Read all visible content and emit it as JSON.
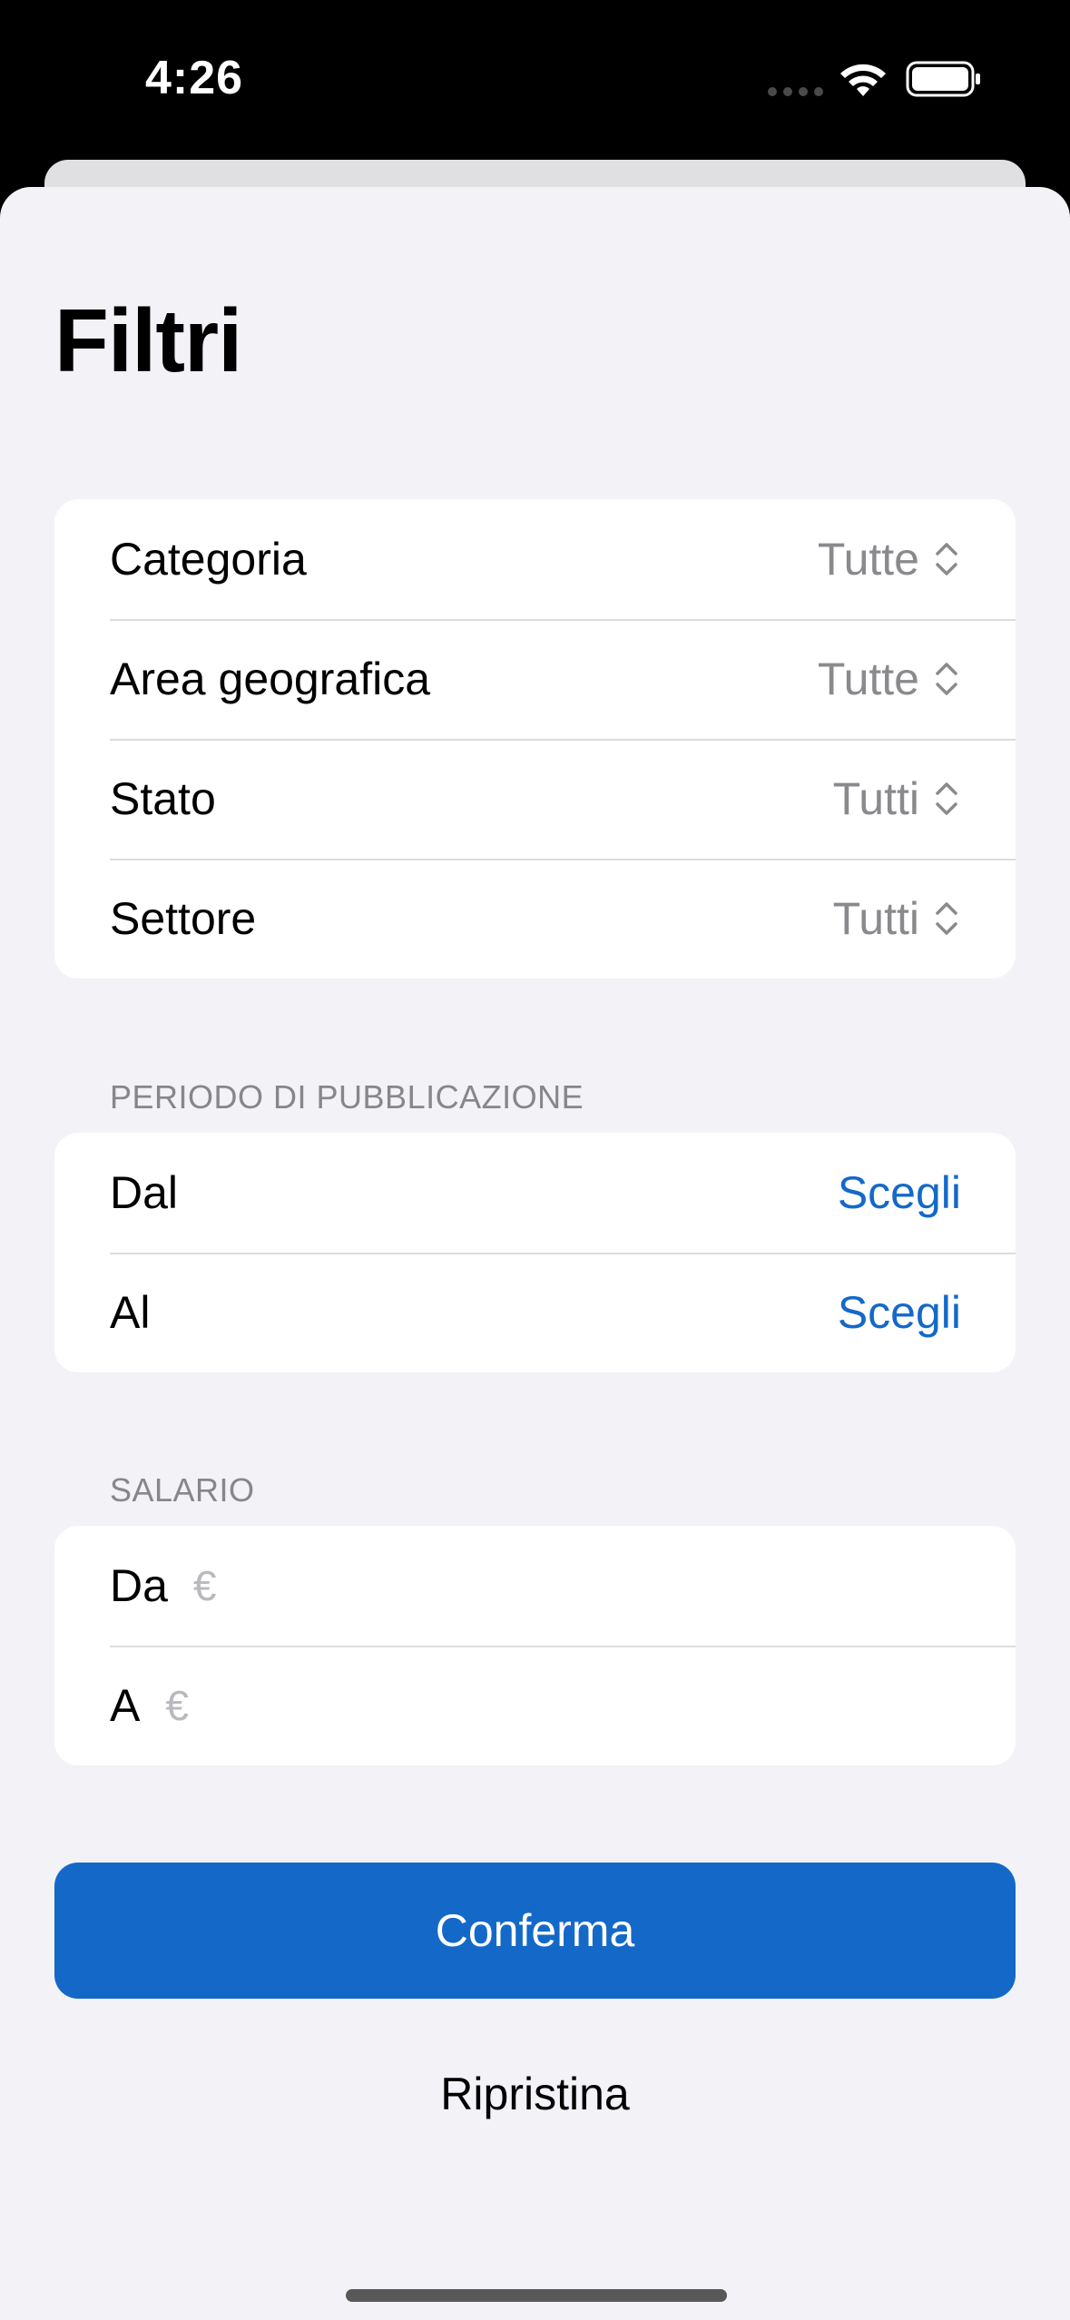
{
  "status_bar": {
    "time": "4:26"
  },
  "title": "Filtri",
  "filters": [
    {
      "label": "Categoria",
      "value": "Tutte",
      "icon": "chevron-up-down-icon"
    },
    {
      "label": "Area geografica",
      "value": "Tutte",
      "icon": "chevron-up-down-icon"
    },
    {
      "label": "Stato",
      "value": "Tutti",
      "icon": "chevron-up-down-icon"
    },
    {
      "label": "Settore",
      "value": "Tutti",
      "icon": "chevron-up-down-icon"
    }
  ],
  "publication_period": {
    "header": "PERIODO DI PUBBLICAZIONE",
    "from": {
      "label": "Dal",
      "action": "Scegli"
    },
    "to": {
      "label": "Al",
      "action": "Scegli"
    }
  },
  "salary": {
    "header": "SALARIO",
    "from": {
      "label": "Da",
      "placeholder": "€"
    },
    "to": {
      "label": "A",
      "placeholder": "€"
    }
  },
  "actions": {
    "confirm": "Conferma",
    "reset": "Ripristina"
  },
  "colors": {
    "accent": "#1469c8",
    "background": "#f2f2f7",
    "secondary_text": "#8a8a8e"
  }
}
